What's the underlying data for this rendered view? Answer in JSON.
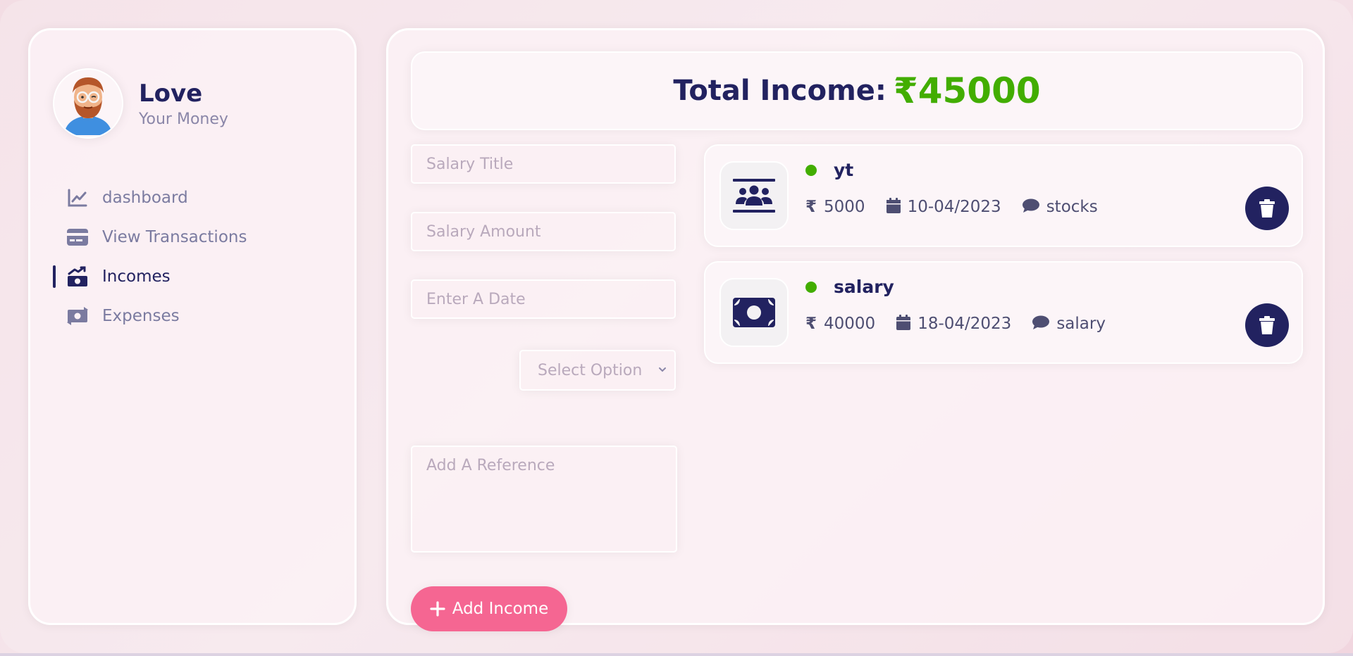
{
  "profile": {
    "name": "Love",
    "subtitle": "Your Money",
    "avatar_icon": "avatar-icon"
  },
  "nav": {
    "items": [
      {
        "label": "dashboard",
        "icon": "chart-line-icon",
        "active": false
      },
      {
        "label": "View Transactions",
        "icon": "credit-card-icon",
        "active": false
      },
      {
        "label": "Incomes",
        "icon": "money-bill-trend-icon",
        "active": true
      },
      {
        "label": "Expenses",
        "icon": "money-bill-transfer-icon",
        "active": false
      }
    ]
  },
  "total": {
    "label": "Total Income:",
    "value": "₹45000"
  },
  "form": {
    "title_placeholder": "Salary Title",
    "amount_placeholder": "Salary Amount",
    "date_placeholder": "Enter A Date",
    "select_placeholder": "Select Option",
    "reference_placeholder": "Add A Reference",
    "submit_label": "Add Income"
  },
  "incomes": [
    {
      "title": "yt",
      "currency": "₹",
      "amount": "5000",
      "date": "10-04/2023",
      "description": "stocks",
      "icon": "users-icon"
    },
    {
      "title": "salary",
      "currency": "₹",
      "amount": "40000",
      "date": "18-04/2023",
      "description": "salary",
      "icon": "money-bill-icon"
    }
  ],
  "colors": {
    "primary": "#222260",
    "accent_green": "#42ad00",
    "button_pink": "#f56692"
  }
}
